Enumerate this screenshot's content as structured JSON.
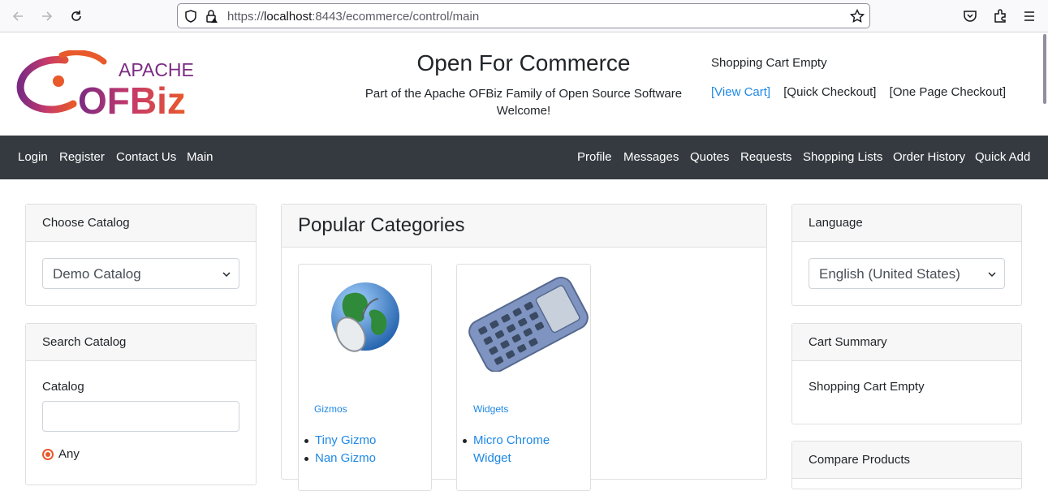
{
  "browser": {
    "url_prefix": "https://",
    "url_host": "localhost",
    "url_rest": ":8443/ecommerce/control/main"
  },
  "header": {
    "logo_text_top": "APACHE",
    "logo_text_main": "OFBiz",
    "site_title": "Open For Commerce",
    "tagline": "Part of the Apache OFBiz Family of Open Source Software",
    "welcome": "Welcome!",
    "cart_status": "Shopping Cart Empty",
    "view_cart": "[View Cart]",
    "quick_checkout": "[Quick Checkout]",
    "one_page_checkout": "[One Page Checkout]"
  },
  "nav": {
    "left": [
      "Login",
      "Register",
      "Contact Us",
      "Main"
    ],
    "right": [
      "Profile",
      "Messages",
      "Quotes",
      "Requests",
      "Shopping Lists",
      "Order History",
      "Quick Add"
    ]
  },
  "left": {
    "choose_catalog_title": "Choose Catalog",
    "catalog_selected": "Demo Catalog",
    "search_catalog_title": "Search Catalog",
    "catalog_label": "Catalog",
    "catalog_input_value": "",
    "radio_any": "Any"
  },
  "center": {
    "title": "Popular Categories",
    "categories": [
      {
        "name": "Gizmos",
        "items": [
          "Tiny Gizmo",
          "Nan Gizmo"
        ]
      },
      {
        "name": "Widgets",
        "items": [
          "Micro Chrome Widget"
        ]
      }
    ]
  },
  "right": {
    "language_title": "Language",
    "language_selected": "English (United States)",
    "cart_summary_title": "Cart Summary",
    "cart_summary_text": "Shopping Cart Empty",
    "compare_title": "Compare Products"
  },
  "colors": {
    "nav_bg": "#343a40",
    "link": "#1e88e5",
    "radio_accent": "#e8592b"
  }
}
